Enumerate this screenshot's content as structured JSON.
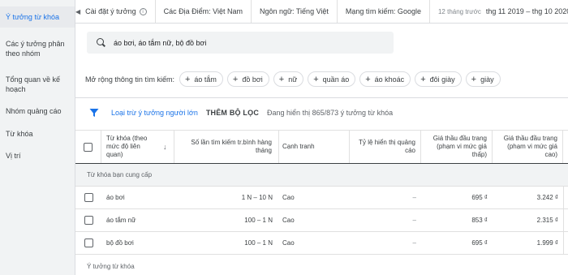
{
  "sidebar": {
    "items": [
      {
        "label": "Ý tưởng từ khóa",
        "active": true
      },
      {
        "label": "Các ý tưởng phân theo nhóm"
      },
      {
        "label": "Tổng quan về kế hoạch"
      },
      {
        "label": "Nhóm quảng cáo"
      },
      {
        "label": "Từ khóa"
      },
      {
        "label": "Vị trí"
      }
    ]
  },
  "topbar": {
    "collapse_icon": "caret-left-icon",
    "settings_label": "Cài đặt ý tưởng",
    "location": "Các Địa Điểm: Việt Nam",
    "language": "Ngôn ngữ: Tiếng Việt",
    "network": "Mạng tìm kiếm: Google",
    "date_label": "12 tháng trước",
    "date_range": "thg 11 2019 – thg 10 2020"
  },
  "search": {
    "value": "áo bơi, áo tắm nữ, bộ đồ bơi",
    "icon": "search-icon"
  },
  "expand": {
    "label": "Mở rộng thông tin tìm kiếm:",
    "chips": [
      "áo tắm",
      "đồ bơi",
      "nữ",
      "quần áo",
      "áo khoác",
      "đôi giày",
      "giày"
    ]
  },
  "filter": {
    "icon": "funnel-icon",
    "exclude_link": "Loại trừ ý tưởng người lớn",
    "add_filter": "THÊM BỘ LỌC",
    "count_text": "Đang hiển thị 865/873 ý tưởng từ khóa"
  },
  "table": {
    "headers": {
      "keyword": "Từ khóa (theo mức độ liên quan)",
      "searches": "Số lần tìm kiếm tr.bình hàng tháng",
      "competition": "Cạnh tranh",
      "impression_share": "Tỷ lệ hiển thị quảng cáo",
      "bid_low": "Giá thầu đầu trang (phạm vi mức giá thấp)",
      "bid_high": "Giá thầu đầu trang (phạm vi mức giá cao)"
    },
    "group1_label": "Từ khóa bạn cung cấp",
    "rows": [
      {
        "keyword": "áo bơi",
        "searches": "1 N – 10 N",
        "competition": "Cao",
        "impression_share": "–",
        "bid_low": "695 ₫",
        "bid_high": "3.242 ₫"
      },
      {
        "keyword": "áo tắm nữ",
        "searches": "100 – 1 N",
        "competition": "Cao",
        "impression_share": "–",
        "bid_low": "853 ₫",
        "bid_high": "2.315 ₫"
      },
      {
        "keyword": "bộ đồ bơi",
        "searches": "100 – 1 N",
        "competition": "Cao",
        "impression_share": "–",
        "bid_low": "695 ₫",
        "bid_high": "1.999 ₫"
      }
    ],
    "group2_label": "Ý tưởng từ khóa"
  },
  "colors": {
    "accent": "#1a73e8",
    "sidebar_bg": "#f1f3f4"
  }
}
